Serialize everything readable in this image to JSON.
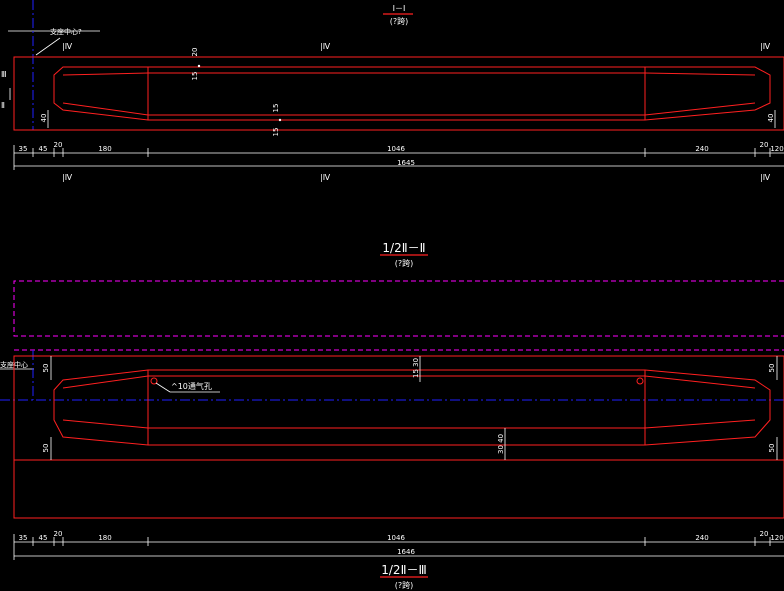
{
  "section1": {
    "title": "I－I",
    "subtitle": "(?跨)",
    "support_label": "支座中心?",
    "marks_top": [
      "|Ⅳ",
      "|Ⅳ",
      "|Ⅳ"
    ],
    "marks_bottom": [
      "|Ⅳ",
      "|Ⅳ",
      "|Ⅳ"
    ],
    "side_mark_top": "Ⅲ",
    "side_mark_bottom": "Ⅱ",
    "vdims": {
      "a": "20",
      "b": "15",
      "c": "15",
      "d": "15",
      "left": "40",
      "right": "40"
    },
    "dims": [
      "35",
      "45",
      "20",
      "180",
      "1046",
      "240",
      "20",
      "120"
    ],
    "total": "1645"
  },
  "section2": {
    "title": "1/2Ⅱ－Ⅱ",
    "subtitle": "(?跨)",
    "support_label": "支座中心",
    "vent_label": "^10通气孔",
    "vdims": {
      "tl": "50",
      "tr": "50",
      "bl": "50",
      "br": "50",
      "mid_top": "15 30",
      "mid_bot": "30 40"
    },
    "dims": [
      "35",
      "45",
      "20",
      "180",
      "1046",
      "240",
      "20",
      "120"
    ],
    "total": "1646"
  },
  "section3": {
    "title": "1/2Ⅱ－Ⅲ",
    "subtitle": "(?跨)"
  },
  "colors": {
    "outline": "#ff2020",
    "centerline": "#2020ff",
    "phantom": "#ff00ff",
    "annotation": "#ffffff"
  }
}
